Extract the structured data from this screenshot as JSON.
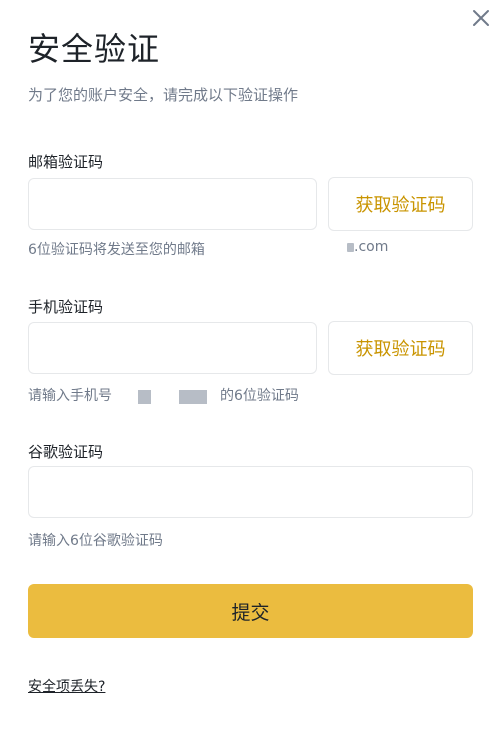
{
  "dialog": {
    "title": "安全验证",
    "subtitle": "为了您的账户安全，请完成以下验证操作",
    "close_icon": "close-icon"
  },
  "email": {
    "label": "邮箱验证码",
    "value": "",
    "button": "获取验证码",
    "hint": "6位验证码将发送至您的邮箱",
    "address_suffix": ".com"
  },
  "phone": {
    "label": "手机验证码",
    "value": "",
    "button": "获取验证码",
    "hint_prefix": "请输入手机号",
    "hint_suffix": "的6位验证码"
  },
  "google": {
    "label": "谷歌验证码",
    "value": "",
    "hint": "请输入6位谷歌验证码"
  },
  "submit_label": "提交",
  "lost_link": "安全项丢失?",
  "colors": {
    "accent": "#ebbc3f",
    "button_text": "#c99400",
    "muted_text": "#707a8a"
  }
}
